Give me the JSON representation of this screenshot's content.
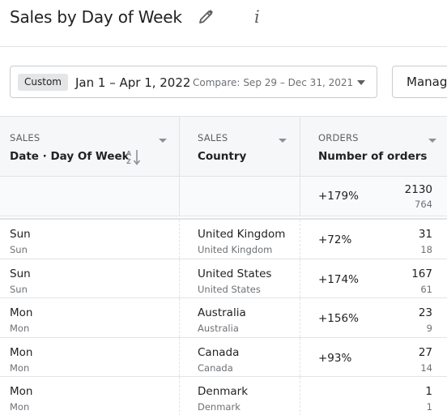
{
  "header": {
    "title": "Sales by Day of Week",
    "edit_icon": "pencil-icon",
    "info_icon": "info-icon",
    "info_glyph": "i"
  },
  "filters": {
    "period_badge": "Custom",
    "date_range": "Jan 1 – Apr 1, 2022",
    "compare_label": "Compare:",
    "compare_range": "Sep 29 – Dec 31, 2021",
    "manage_label": "Manage"
  },
  "table": {
    "columns": [
      {
        "category": "SALES",
        "name": "Date · Day Of Week",
        "sorted": "a-z"
      },
      {
        "category": "SALES",
        "name": "Country"
      },
      {
        "category": "ORDERS",
        "name": "Number of orders"
      }
    ],
    "totals": {
      "change": "+179%",
      "current": "2130",
      "previous": "764"
    },
    "rows": [
      {
        "day": "Sun",
        "day_prev": "Sun",
        "country": "United Kingdom",
        "country_prev": "United Kingdom",
        "change": "+72%",
        "current": "31",
        "previous": "18"
      },
      {
        "day": "Sun",
        "day_prev": "Sun",
        "country": "United States",
        "country_prev": "United States",
        "change": "+174%",
        "current": "167",
        "previous": "61"
      },
      {
        "day": "Mon",
        "day_prev": "Mon",
        "country": "Australia",
        "country_prev": "Australia",
        "change": "+156%",
        "current": "23",
        "previous": "9"
      },
      {
        "day": "Mon",
        "day_prev": "Mon",
        "country": "Canada",
        "country_prev": "Canada",
        "change": "+93%",
        "current": "27",
        "previous": "14"
      },
      {
        "day": "Mon",
        "day_prev": "Mon",
        "country": "Denmark",
        "country_prev": "Denmark",
        "change": "",
        "current": "1",
        "previous": "1"
      }
    ]
  }
}
